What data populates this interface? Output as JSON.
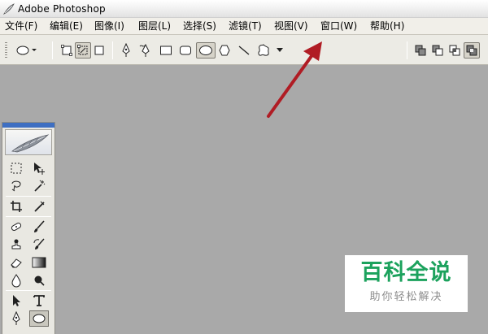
{
  "window": {
    "title": "Adobe Photoshop",
    "icon": "photoshop-feather-icon"
  },
  "menu": {
    "items": [
      {
        "label": "文件(F)"
      },
      {
        "label": "编辑(E)"
      },
      {
        "label": "图像(I)"
      },
      {
        "label": "图层(L)"
      },
      {
        "label": "选择(S)"
      },
      {
        "label": "滤镜(T)"
      },
      {
        "label": "视图(V)"
      },
      {
        "label": "窗口(W)"
      },
      {
        "label": "帮助(H)"
      }
    ]
  },
  "options_bar": {
    "tool_preset_icon": "ellipse-preset-icon",
    "mode_icons": [
      "shape-layers-icon",
      "paths-icon",
      "fill-pixels-icon"
    ],
    "shape_icons": [
      "pen-icon",
      "freeform-pen-icon",
      "rectangle-icon",
      "rounded-rectangle-icon",
      "ellipse-icon",
      "polygon-icon",
      "line-icon",
      "custom-shape-icon",
      "dropdown-arrow-icon"
    ],
    "selected_shape": "ellipse-icon",
    "combine_icons": [
      "add-to-shape-icon",
      "subtract-from-shape-icon",
      "intersect-shape-icon",
      "exclude-overlap-icon"
    ]
  },
  "toolbox": {
    "header_color": "#3e6fc2",
    "logo": "photoshop-feather-logo",
    "tools": [
      "marquee-tool",
      "move-tool",
      "lasso-tool",
      "magic-wand-tool",
      "crop-tool",
      "slice-tool",
      "healing-brush-tool",
      "brush-tool",
      "clone-stamp-tool",
      "history-brush-tool",
      "eraser-tool",
      "gradient-tool",
      "blur-tool",
      "dodge-tool",
      "path-selection-tool",
      "type-tool",
      "pen-tool",
      "ellipse-tool"
    ]
  },
  "annotation": {
    "color": "#b01c24",
    "target": "窗口(W)"
  },
  "watermark": {
    "title": "百科全说",
    "subtitle": "助你轻松解决",
    "title_color": "#1ca25d"
  }
}
